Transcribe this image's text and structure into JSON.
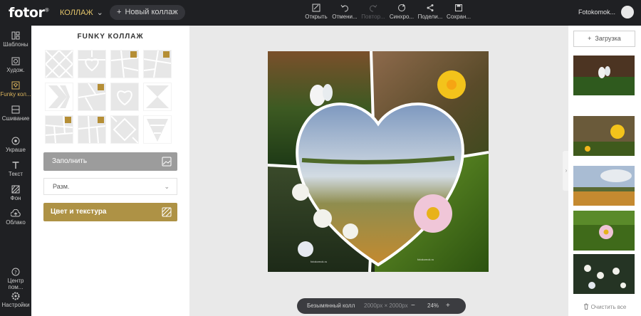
{
  "app": {
    "logo": "fotor",
    "logo_mark": "®",
    "mode": "КОЛЛАЖ",
    "new_collage": "Новый коллаж",
    "user": "Fotokomok..."
  },
  "toolbar": [
    {
      "label": "Открыть",
      "icon": "open-icon",
      "disabled": false
    },
    {
      "label": "Отмени...",
      "icon": "undo-icon",
      "disabled": false
    },
    {
      "label": "Повтор...",
      "icon": "redo-icon",
      "disabled": true
    },
    {
      "label": "Синхро...",
      "icon": "sync-icon",
      "disabled": false
    },
    {
      "label": "Подели...",
      "icon": "share-icon",
      "disabled": false
    },
    {
      "label": "Сохран...",
      "icon": "save-icon",
      "disabled": false
    }
  ],
  "nav": [
    {
      "label": "Шаблоны",
      "icon": "templates-icon"
    },
    {
      "label": "Худож.",
      "icon": "artistic-icon"
    },
    {
      "label": "Funky кол...",
      "icon": "funky-collage-icon",
      "active": true
    },
    {
      "label": "Сшивание",
      "icon": "stitching-icon"
    },
    {
      "label": "Украше",
      "icon": "decorate-icon"
    },
    {
      "label": "Текст",
      "icon": "text-icon"
    },
    {
      "label": "Фон",
      "icon": "background-icon"
    },
    {
      "label": "Облако",
      "icon": "cloud-icon"
    },
    {
      "label": "Центр пом...",
      "icon": "help-center-icon"
    },
    {
      "label": "Настройки",
      "icon": "settings-icon"
    }
  ],
  "panel": {
    "title": "FUNKY КОЛЛАЖ",
    "fill_label": "Заполнить",
    "size_label": "Разм.",
    "color_label": "Цвет и текстура",
    "templates_premium": [
      false,
      false,
      true,
      true,
      false,
      true,
      false,
      false,
      true,
      true,
      false,
      false
    ]
  },
  "canvas": {
    "watermark": "fotokomok.ru"
  },
  "status": {
    "name": "Безымянный колл",
    "size": "2000px × 2000px",
    "zoom": "24%",
    "minus": "−",
    "plus": "+"
  },
  "right": {
    "upload": "Загрузка",
    "upload_plus": "+",
    "clear_all": "Очистить все"
  },
  "colors": {
    "accent": "#ae9245",
    "topbar": "#1f2023"
  }
}
